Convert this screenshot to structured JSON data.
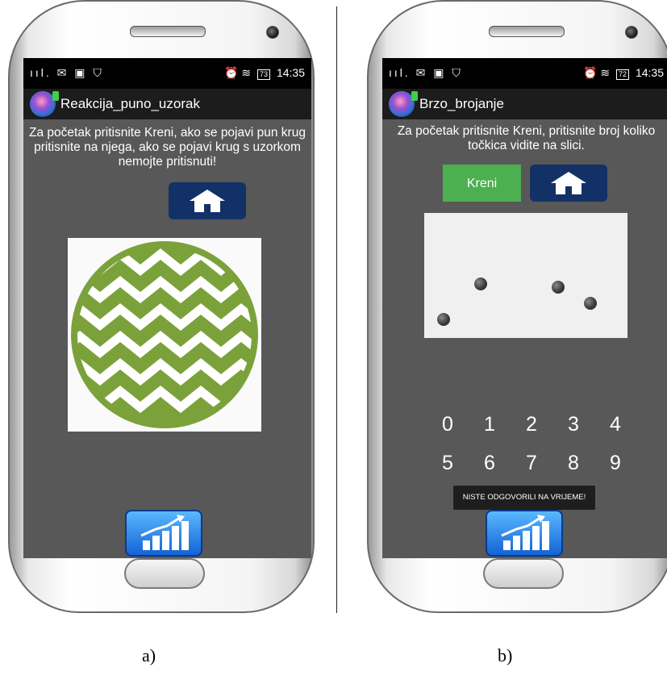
{
  "screen_a": {
    "status": {
      "signal": "ııl.",
      "time": "14:35",
      "battery": "73"
    },
    "app_title": "Reakcija_puno_uzorak",
    "instructions": "Za početak pritisnite Kreni, ako se pojavi pun krug pritisnite na njega, ako se pojavi krug s uzorkom nemojte pritisnuti!",
    "icons": {
      "home": "home-icon",
      "stats": "chart-icon",
      "pattern": "zigzag-circle"
    },
    "colors": {
      "pattern_green": "#7ba23a",
      "home_button": "#123166"
    }
  },
  "screen_b": {
    "status": {
      "signal": "ııl.",
      "time": "14:35",
      "battery": "72"
    },
    "app_title": "Brzo_brojanje",
    "instructions": "Za početak pritisnite Kreni, pritisnite broj koliko točkica vidite na slici.",
    "kreni_label": "Kreni",
    "digits_row1": [
      "0",
      "1",
      "2",
      "3",
      "4"
    ],
    "digits_row2": [
      "5",
      "6",
      "7",
      "8",
      "9"
    ],
    "toast": "NISTE ODGOVORILI NA VRIJEME!",
    "dot_count": 4,
    "colors": {
      "kreni_button": "#4caf50",
      "home_button": "#123166"
    }
  },
  "captions": {
    "a": "a)",
    "b": "b)"
  }
}
